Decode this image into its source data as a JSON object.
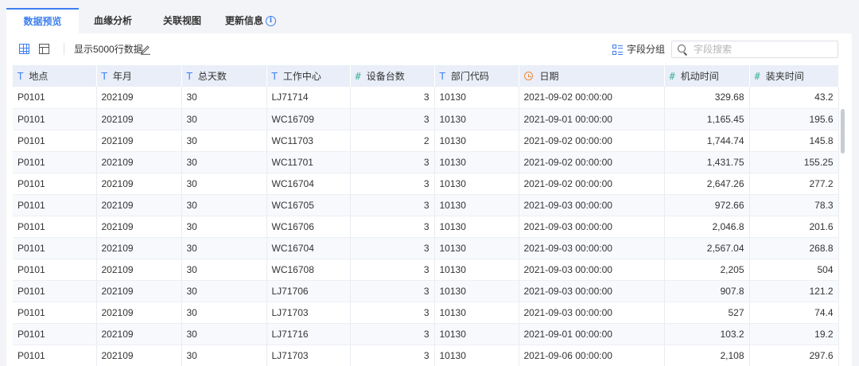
{
  "tabs": [
    {
      "label": "数据预览",
      "active": true
    },
    {
      "label": "血缘分析",
      "active": false
    },
    {
      "label": "关联视图",
      "active": false
    },
    {
      "label": "更新信息",
      "active": false
    }
  ],
  "toolbar": {
    "row_count_label": "显示5000行数据",
    "group_label": "字段分组",
    "search_placeholder": "字段搜索"
  },
  "columns": [
    {
      "label": "地点",
      "type_icon": "T",
      "type": "text"
    },
    {
      "label": "年月",
      "type_icon": "T",
      "type": "text"
    },
    {
      "label": "总天数",
      "type_icon": "T",
      "type": "text"
    },
    {
      "label": "工作中心",
      "type_icon": "T",
      "type": "text"
    },
    {
      "label": "设备台数",
      "type_icon": "#",
      "type": "number"
    },
    {
      "label": "部门代码",
      "type_icon": "T",
      "type": "text"
    },
    {
      "label": "日期",
      "type_icon": "clock",
      "type": "date"
    },
    {
      "label": "机动时间",
      "type_icon": "#",
      "type": "number"
    },
    {
      "label": "装夹时间",
      "type_icon": "#",
      "type": "number"
    }
  ],
  "rows": [
    [
      "P0101",
      "202109",
      "30",
      "LJ71714",
      "3",
      "10130",
      "2021-09-02 00:00:00",
      "329.68",
      "43.2"
    ],
    [
      "P0101",
      "202109",
      "30",
      "WC16709",
      "3",
      "10130",
      "2021-09-01 00:00:00",
      "1,165.45",
      "195.6"
    ],
    [
      "P0101",
      "202109",
      "30",
      "WC11703",
      "2",
      "10130",
      "2021-09-02 00:00:00",
      "1,744.74",
      "145.8"
    ],
    [
      "P0101",
      "202109",
      "30",
      "WC11701",
      "3",
      "10130",
      "2021-09-02 00:00:00",
      "1,431.75",
      "155.25"
    ],
    [
      "P0101",
      "202109",
      "30",
      "WC16704",
      "3",
      "10130",
      "2021-09-02 00:00:00",
      "2,647.26",
      "277.2"
    ],
    [
      "P0101",
      "202109",
      "30",
      "WC16705",
      "3",
      "10130",
      "2021-09-03 00:00:00",
      "972.66",
      "78.3"
    ],
    [
      "P0101",
      "202109",
      "30",
      "WC16706",
      "3",
      "10130",
      "2021-09-03 00:00:00",
      "2,046.8",
      "201.6"
    ],
    [
      "P0101",
      "202109",
      "30",
      "WC16704",
      "3",
      "10130",
      "2021-09-03 00:00:00",
      "2,567.04",
      "268.8"
    ],
    [
      "P0101",
      "202109",
      "30",
      "WC16708",
      "3",
      "10130",
      "2021-09-03 00:00:00",
      "2,205",
      "504"
    ],
    [
      "P0101",
      "202109",
      "30",
      "LJ71706",
      "3",
      "10130",
      "2021-09-03 00:00:00",
      "907.8",
      "121.2"
    ],
    [
      "P0101",
      "202109",
      "30",
      "LJ71703",
      "3",
      "10130",
      "2021-09-03 00:00:00",
      "527",
      "74.4"
    ],
    [
      "P0101",
      "202109",
      "30",
      "LJ71716",
      "3",
      "10130",
      "2021-09-01 00:00:00",
      "103.2",
      "19.2"
    ],
    [
      "P0101",
      "202109",
      "30",
      "LJ71703",
      "3",
      "10130",
      "2021-09-06 00:00:00",
      "2,108",
      "297.6"
    ]
  ],
  "colors": {
    "accent": "#3d7ff0",
    "number_icon": "#3fb29a",
    "date_icon": "#f08a3d",
    "header_bg": "#e9eef8"
  }
}
